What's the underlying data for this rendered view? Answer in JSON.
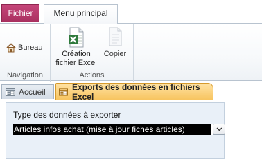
{
  "ribbon": {
    "file_tab": "Fichier",
    "main_tab": "Menu principal",
    "groups": {
      "navigation": {
        "label": "Navigation",
        "bureau_label": "Bureau"
      },
      "actions": {
        "label": "Actions",
        "excel_label_line1": "Création",
        "excel_label_line2": "fichier Excel",
        "copier_label": "Copier"
      }
    }
  },
  "doc_tabs": {
    "accueil": "Accueil",
    "active": "Exports des données en fichiers Excel"
  },
  "form": {
    "field_label": "Type des données à exporter",
    "selected_value": "Articles infos achat (mise à jour fiches articles)"
  },
  "colors": {
    "file_tab": "#b83a6b",
    "active_doc_tab": "#f7c35d",
    "form_panel": "#e9f0f8"
  },
  "icons": {
    "bureau": "home-icon",
    "excel": "excel-file-icon",
    "copier": "copy-document-icon",
    "form": "form-icon",
    "dropdown": "chevron-down-icon"
  }
}
